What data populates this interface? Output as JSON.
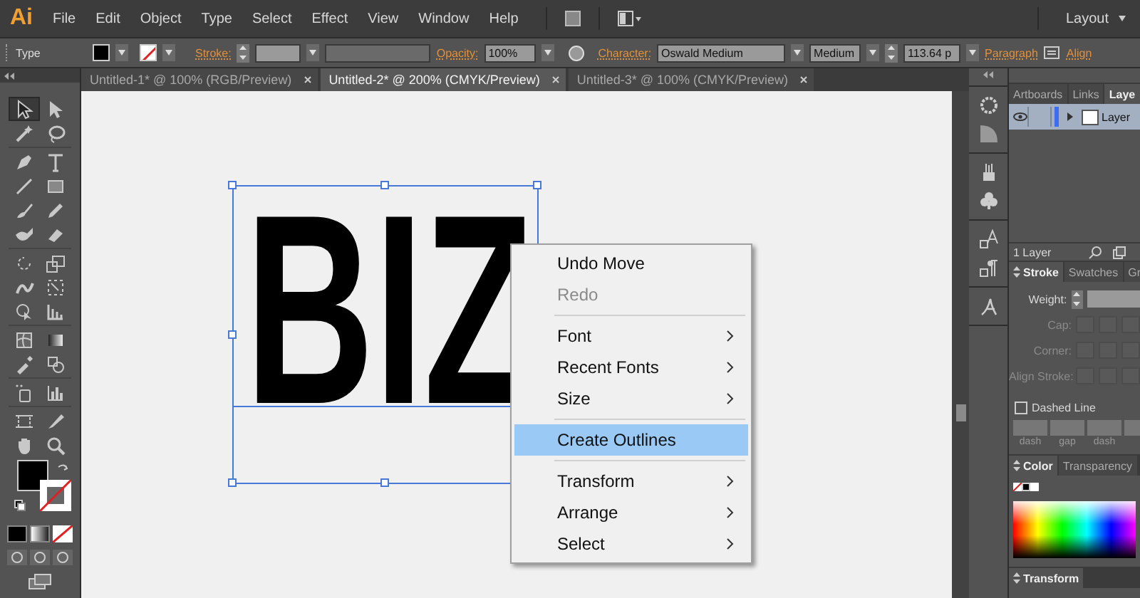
{
  "app": {
    "logo": "Ai",
    "menu": [
      "File",
      "Edit",
      "Object",
      "Type",
      "Select",
      "Effect",
      "View",
      "Window",
      "Help"
    ],
    "workspace": "Layout"
  },
  "control_bar": {
    "label": "Type",
    "stroke_label": "Stroke:",
    "opacity_label": "Opacity:",
    "opacity": "100%",
    "character_label": "Character:",
    "font": "Oswald Medium",
    "style": "Medium",
    "size": "113.64 p",
    "paragraph_label": "Paragraph",
    "align_label": "Align"
  },
  "tabs": [
    {
      "label": "Untitled-1* @ 100% (RGB/Preview)",
      "selected": false
    },
    {
      "label": "Untitled-2* @ 200% (CMYK/Preview)",
      "selected": true
    },
    {
      "label": "Untitled-3* @ 100% (CMYK/Preview)",
      "selected": false
    }
  ],
  "tools": [
    {
      "selected": true
    },
    {
      "selected": false
    },
    {
      "selected": false
    },
    {
      "selected": false
    },
    {
      "selected": false
    },
    {
      "selected": false
    },
    {
      "selected": false
    },
    {
      "selected": false
    },
    {
      "selected": false
    },
    {
      "selected": false
    },
    {
      "selected": false
    },
    {
      "selected": false
    },
    {
      "selected": false
    },
    {
      "selected": false
    },
    {
      "selected": false
    },
    {
      "selected": false
    },
    {
      "selected": false
    },
    {
      "selected": false
    },
    {
      "selected": false
    },
    {
      "selected": false
    },
    {
      "selected": false
    },
    {
      "selected": false
    },
    {
      "selected": false
    },
    {
      "selected": false
    },
    {
      "selected": false
    },
    {
      "selected": false
    },
    {
      "selected": false
    },
    {
      "selected": false
    }
  ],
  "canvas": {
    "text": "BIZ"
  },
  "context_menu": [
    {
      "kind": "item",
      "label": "Undo Move",
      "disabled": false,
      "selected": false,
      "submenu": false
    },
    {
      "kind": "item",
      "label": "Redo",
      "disabled": true,
      "selected": false,
      "submenu": false
    },
    {
      "kind": "separator"
    },
    {
      "kind": "item",
      "label": "Font",
      "disabled": false,
      "selected": false,
      "submenu": true
    },
    {
      "kind": "item",
      "label": "Recent Fonts",
      "disabled": false,
      "selected": false,
      "submenu": true
    },
    {
      "kind": "item",
      "label": "Size",
      "disabled": false,
      "selected": false,
      "submenu": true
    },
    {
      "kind": "separator"
    },
    {
      "kind": "item",
      "label": "Create Outlines",
      "disabled": false,
      "selected": true,
      "submenu": false
    },
    {
      "kind": "separator"
    },
    {
      "kind": "item",
      "label": "Transform",
      "disabled": false,
      "selected": false,
      "submenu": true
    },
    {
      "kind": "item",
      "label": "Arrange",
      "disabled": false,
      "selected": false,
      "submenu": true
    },
    {
      "kind": "item",
      "label": "Select",
      "disabled": false,
      "selected": false,
      "submenu": true
    }
  ],
  "layers_panel": {
    "tabs": [
      {
        "label": "Artboards",
        "selected": false
      },
      {
        "label": "Links",
        "selected": false
      },
      {
        "label": "Laye",
        "selected": true
      }
    ],
    "layers": [
      {
        "name": "Layer",
        "visible": true
      }
    ],
    "count": "1 Layer"
  },
  "stroke_panel": {
    "tabs": [
      {
        "label": "Stroke",
        "selected": true
      },
      {
        "label": "Swatches",
        "selected": false
      },
      {
        "label": "Gr",
        "selected": false
      }
    ],
    "weight_label": "Weight:",
    "cap_label": "Cap:",
    "corner_label": "Corner:",
    "align_label": "Align Stroke:",
    "options_disabled": true,
    "dashed_label": "Dashed Line",
    "dashed": false,
    "dash_labels": [
      "dash",
      "gap",
      "dash"
    ]
  },
  "color_panel": {
    "tabs": [
      {
        "label": "Color",
        "selected": true
      },
      {
        "label": "Transparency",
        "selected": false
      }
    ]
  },
  "transform_panel": {
    "title": "Transform"
  }
}
